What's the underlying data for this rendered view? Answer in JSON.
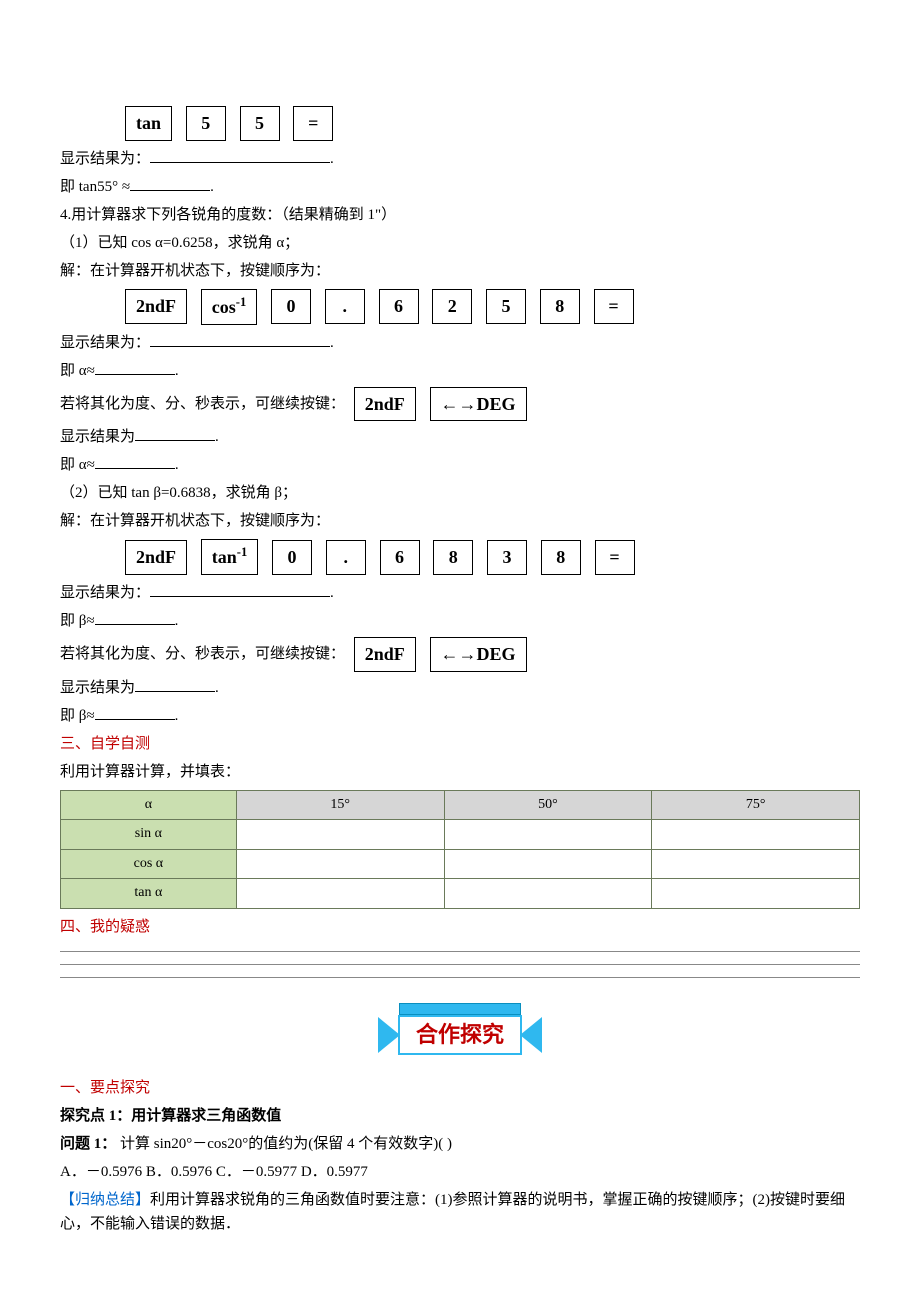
{
  "keys3": {
    "k1": "tan",
    "k2": "5",
    "k3": "5",
    "k4": "="
  },
  "line_display_result": "显示结果为：",
  "line_tan55": "即 tan55° ≈",
  "item4_title": "4.用计算器求下列各锐角的度数：（结果精确到 1\"）",
  "item4_1": "（1）已知 cos α=0.6258，求锐角 α；",
  "solution_prefix": "解：在计算器开机状态下，按键顺序为：",
  "keys4_1": {
    "k1": "2ndF",
    "k2": "cos",
    "k2sup": "-1",
    "k3": "0",
    "k4": ".",
    "k5": "6",
    "k6": "2",
    "k7": "5",
    "k8": "8",
    "k9": "="
  },
  "line_alpha_approx": "即 α≈",
  "convert_prefix": "若将其化为度、分、秒表示，可继续按键：",
  "keys_convert": {
    "k1": "2ndF",
    "k2": "←→DEG"
  },
  "display_result_short": "显示结果为",
  "item4_2": "（2）已知 tan β=0.6838，求锐角 β；",
  "keys4_2": {
    "k1": "2ndF",
    "k2": "tan",
    "k2sup": "-1",
    "k3": "0",
    "k4": ".",
    "k5": "6",
    "k6": "8",
    "k7": "3",
    "k8": "8",
    "k9": "="
  },
  "line_beta_approx": "即 β≈",
  "section3": "三、自学自测",
  "section3_desc": "利用计算器计算，并填表：",
  "table": {
    "header": [
      "α",
      "15°",
      "50°",
      "75°"
    ],
    "rows": [
      "sin α",
      "cos α",
      "tan α"
    ]
  },
  "section4": "四、我的疑惑",
  "banner": "合作探究",
  "section_a": "一、要点探究",
  "topic1": "探究点 1：用计算器求三角函数值",
  "q1_label": "问题 1：",
  "q1_text": "  计算 sin20°－cos20°的值约为(保留 4 个有效数字)(        )",
  "options": "A．－0.5976        B．0.5976        C．－0.5977        D．0.5977",
  "summary_tag": "【归纳总结】",
  "summary_text": "利用计算器求锐角的三角函数值时要注意：(1)参照计算器的说明书，掌握正确的按键顺序；(2)按键时要细心，不能输入错误的数据．",
  "period": "."
}
